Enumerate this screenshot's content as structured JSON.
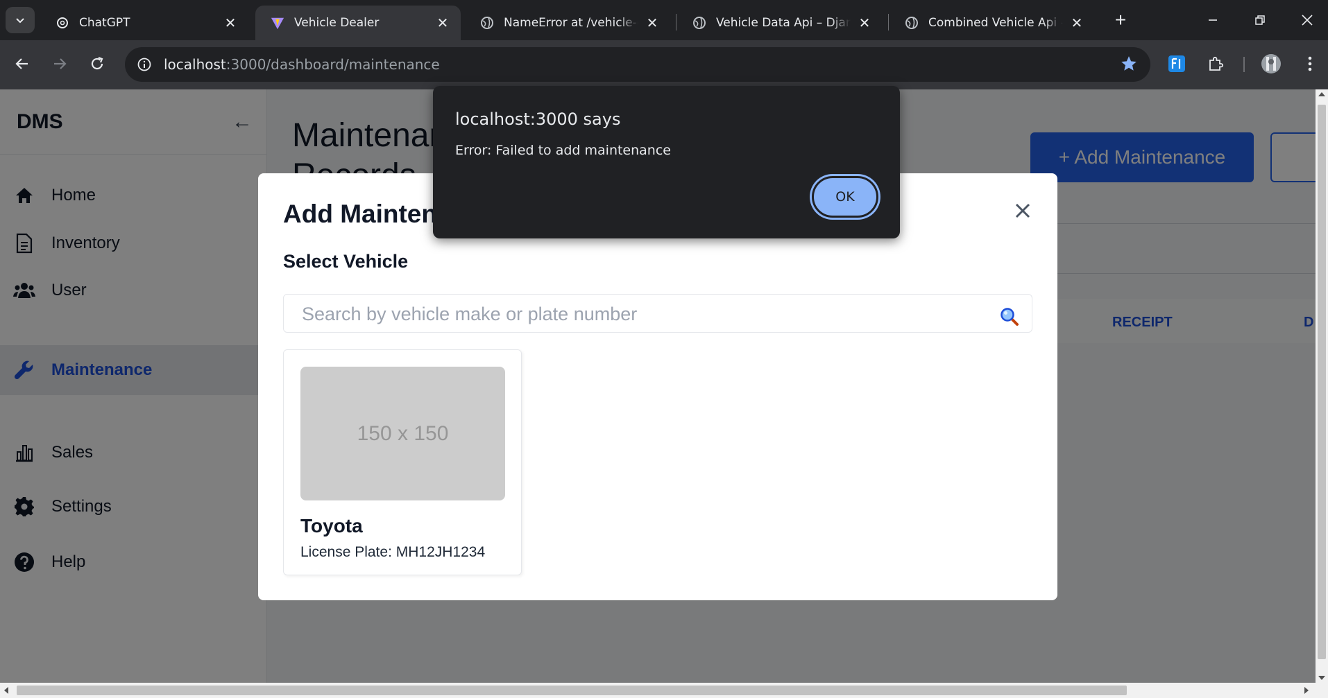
{
  "browser": {
    "tabs": [
      {
        "title": "ChatGPT",
        "active": false
      },
      {
        "title": "Vehicle Dealer",
        "active": true
      },
      {
        "title": "NameError at /vehicle-data",
        "active": false
      },
      {
        "title": "Vehicle Data Api – Django",
        "active": false
      },
      {
        "title": "Combined Vehicle Api – Dj",
        "active": false
      }
    ],
    "url_host": "localhost",
    "url_path": ":3000/dashboard/maintenance"
  },
  "sidebar": {
    "brand": "DMS",
    "collapse_glyph": "←",
    "items": [
      {
        "label": "Home",
        "icon": "home-icon",
        "active": false
      },
      {
        "label": "Inventory",
        "icon": "document-icon",
        "active": false
      },
      {
        "label": "User",
        "icon": "users-icon",
        "active": false
      },
      {
        "label": "Maintenance",
        "icon": "wrench-icon",
        "active": true
      },
      {
        "label": "Sales",
        "icon": "bar-chart-icon",
        "active": false
      },
      {
        "label": "Settings",
        "icon": "gear-icon",
        "active": false
      },
      {
        "label": "Help",
        "icon": "help-icon",
        "active": false
      }
    ]
  },
  "main": {
    "title": "Maintenance & Records",
    "add_button": "+ Add Maintenance",
    "table_headers": {
      "receipt": "RECEIPT",
      "d": "D"
    }
  },
  "modal": {
    "title": "Add Maintenance",
    "select_label": "Select Vehicle",
    "search_placeholder": "Search by vehicle make or plate number",
    "search_icon": "magnifier-icon",
    "vehicles": [
      {
        "image_text": "150 x 150",
        "make": "Toyota",
        "plate": "License Plate: MH12JH1234"
      }
    ]
  },
  "alert": {
    "title": "localhost:3000 says",
    "message": "Error: Failed to add maintenance",
    "ok_label": "OK"
  },
  "colors": {
    "accent": "#2563eb",
    "alert_button": "#8ab4f8",
    "chrome_dark": "#202124"
  }
}
